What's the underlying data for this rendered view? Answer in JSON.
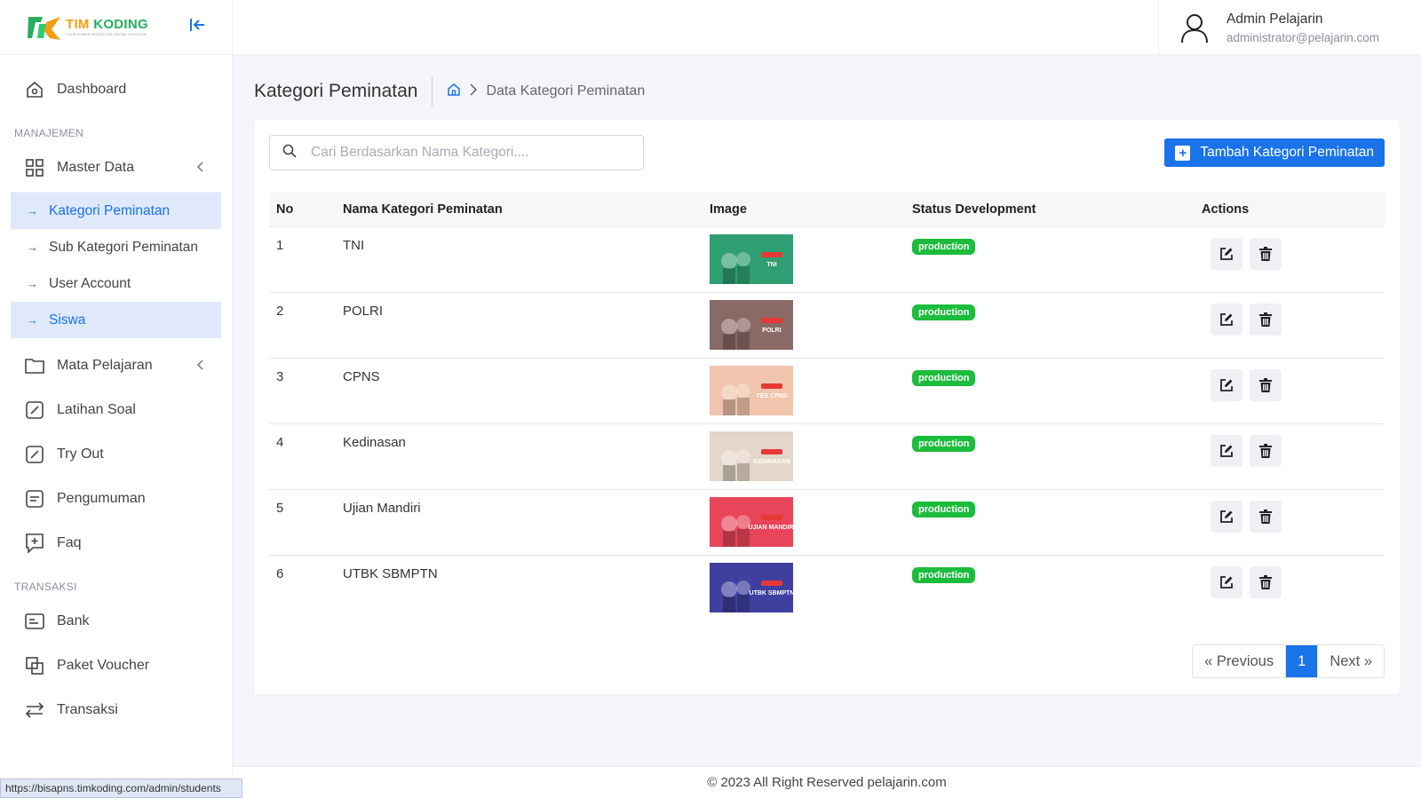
{
  "brand": {
    "name_part1": "TIM",
    "name_part2": "KODING",
    "tagline": "YOUR POWER HOUSE FOR DIGITAL SOLUTION"
  },
  "sidebar": {
    "dashboard": "Dashboard",
    "section_manajemen": "MANAJEMEN",
    "master_data": "Master Data",
    "master_sub": [
      "Kategori Peminatan",
      "Sub Kategori Peminatan",
      "User Account",
      "Siswa"
    ],
    "mata_pelajaran": "Mata Pelajaran",
    "latihan_soal": "Latihan Soal",
    "try_out": "Try Out",
    "pengumuman": "Pengumuman",
    "faq": "Faq",
    "section_transaksi": "TRANSAKSI",
    "bank": "Bank",
    "paket_voucher": "Paket Voucher",
    "transaksi": "Transaksi"
  },
  "user": {
    "name": "Admin Pelajarin",
    "email": "administrator@pelajarin.com"
  },
  "page": {
    "title": "Kategori Peminatan",
    "breadcrumb_current": "Data Kategori Peminatan"
  },
  "search": {
    "placeholder": "Cari Berdasarkan Nama Kategori...."
  },
  "add_button": "Tambah Kategori Peminatan",
  "table": {
    "headers": [
      "No",
      "Nama Kategori Peminatan",
      "Image",
      "Status Development",
      "Actions"
    ],
    "rows": [
      {
        "no": "1",
        "name": "TNI",
        "status": "production",
        "img_label": "TNI",
        "img_bg": "#2f9e73"
      },
      {
        "no": "2",
        "name": "POLRI",
        "status": "production",
        "img_label": "POLRI",
        "img_bg": "#8a6a66"
      },
      {
        "no": "3",
        "name": "CPNS",
        "status": "production",
        "img_label": "TES CPNS",
        "img_bg": "#f1c4ad"
      },
      {
        "no": "4",
        "name": "Kedinasan",
        "status": "production",
        "img_label": "KEDINASAN",
        "img_bg": "#e4d6c9"
      },
      {
        "no": "5",
        "name": "Ujian Mandiri",
        "status": "production",
        "img_label": "UJIAN MANDIRI",
        "img_bg": "#e8455a"
      },
      {
        "no": "6",
        "name": "UTBK SBMPTN",
        "status": "production",
        "img_label": "UTBK SBMPTN",
        "img_bg": "#3e3f9e"
      }
    ]
  },
  "pagination": {
    "prev": "« Previous",
    "current": "1",
    "next": "Next »"
  },
  "footer": "© 2023 All Right Reserved pelajarin.com",
  "status_url": "https://bisapns.timkoding.com/admin/students",
  "colors": {
    "accent": "#1a73e8",
    "badge": "#1cbc3c",
    "active_bg": "#dfe9fb"
  }
}
